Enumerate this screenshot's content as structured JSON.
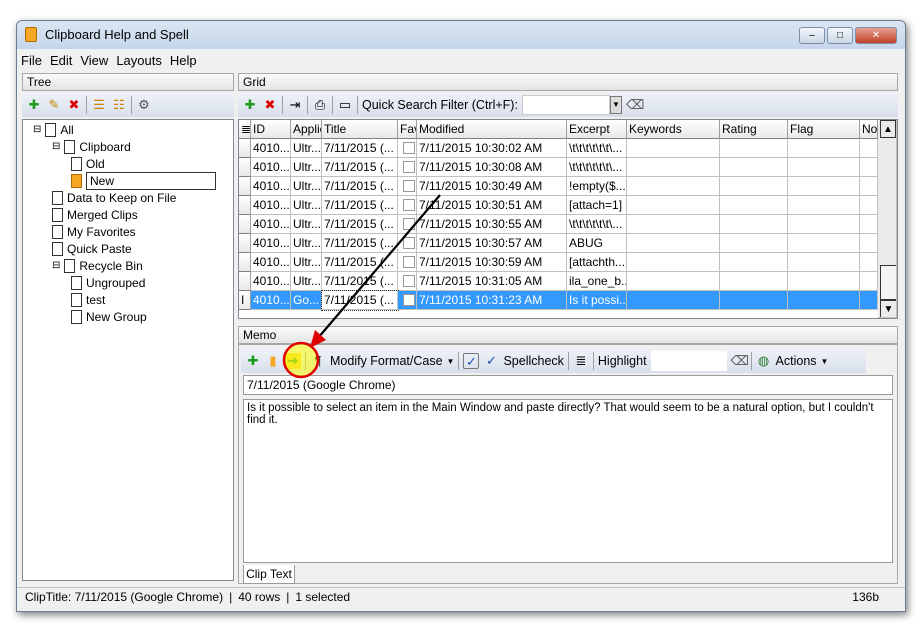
{
  "window": {
    "title": "Clipboard Help and Spell"
  },
  "menu": [
    "File",
    "Edit",
    "View",
    "Layouts",
    "Help"
  ],
  "tree": {
    "header": "Tree",
    "nodes": [
      {
        "label": "All",
        "level": 0
      },
      {
        "label": "Clipboard",
        "level": 1
      },
      {
        "label": "Old",
        "level": 2
      },
      {
        "label": "New",
        "level": 2,
        "selected": true
      },
      {
        "label": "Data to Keep on File",
        "level": 1
      },
      {
        "label": "Merged Clips",
        "level": 1
      },
      {
        "label": "My Favorites",
        "level": 1
      },
      {
        "label": "Quick Paste",
        "level": 1
      },
      {
        "label": "Recycle Bin",
        "level": 1
      },
      {
        "label": "Ungrouped",
        "level": 2
      },
      {
        "label": "test",
        "level": 2
      },
      {
        "label": "New Group",
        "level": 2
      }
    ]
  },
  "grid": {
    "header": "Grid",
    "search_label": "Quick Search Filter (Ctrl+F):",
    "search_value": "",
    "columns": [
      "ID",
      "Applic",
      "Title",
      "Fav",
      "Modified",
      "Excerpt",
      "Keywords",
      "Rating",
      "Flag",
      "No"
    ],
    "rows": [
      [
        "4010...",
        "Ultr...",
        "7/11/2015 (...",
        "",
        "7/11/2015 10:30:02 AM",
        "\\t\\t\\t\\t\\t\\t\\..."
      ],
      [
        "4010...",
        "Ultr...",
        "7/11/2015 (...",
        "",
        "7/11/2015 10:30:08 AM",
        "\\t\\t\\t\\t\\t\\t\\..."
      ],
      [
        "4010...",
        "Ultr...",
        "7/11/2015 (...",
        "",
        "7/11/2015 10:30:49 AM",
        "!empty($..."
      ],
      [
        "4010...",
        "Ultr...",
        "7/11/2015 (...",
        "",
        "7/11/2015 10:30:51 AM",
        "[attach=1]"
      ],
      [
        "4010...",
        "Ultr...",
        "7/11/2015 (...",
        "",
        "7/11/2015 10:30:55 AM",
        "\\t\\t\\t\\t\\t\\t\\..."
      ],
      [
        "4010...",
        "Ultr...",
        "7/11/2015 (...",
        "",
        "7/11/2015 10:30:57 AM",
        "ABUG"
      ],
      [
        "4010...",
        "Ultr...",
        "7/11/2015 (...",
        "",
        "7/11/2015 10:30:59 AM",
        "[attachth..."
      ],
      [
        "4010...",
        "Ultr...",
        "7/11/2015 (...",
        "",
        "7/11/2015 10:31:05 AM",
        "ila_one_b..."
      ],
      [
        "4010...",
        "Go...",
        "7/11/2015 (...",
        "",
        "7/11/2015 10:31:23 AM",
        "Is it possi..."
      ]
    ],
    "selected_row": 8,
    "selection_color": "#3399ff"
  },
  "memo": {
    "header": "Memo",
    "modify_label": "Modify Format/Case",
    "spellcheck_label": "Spellcheck",
    "highlight_label": "Highlight",
    "highlight_value": "",
    "actions_label": "Actions",
    "title_value": "7/11/2015 (Google Chrome)",
    "text": "Is it possible to select an item in the Main Window and paste directly?  That would seem to be a natural option, but I couldn't find it.",
    "tab": "Clip Text"
  },
  "status": {
    "cliptitle": "ClipTitle:  7/11/2015 (Google Chrome)",
    "rows": "40 rows",
    "selected": "1 selected",
    "size": "136b"
  },
  "annotation": {
    "highlight_color": "#ffff00",
    "ring_color": "#e00000"
  }
}
